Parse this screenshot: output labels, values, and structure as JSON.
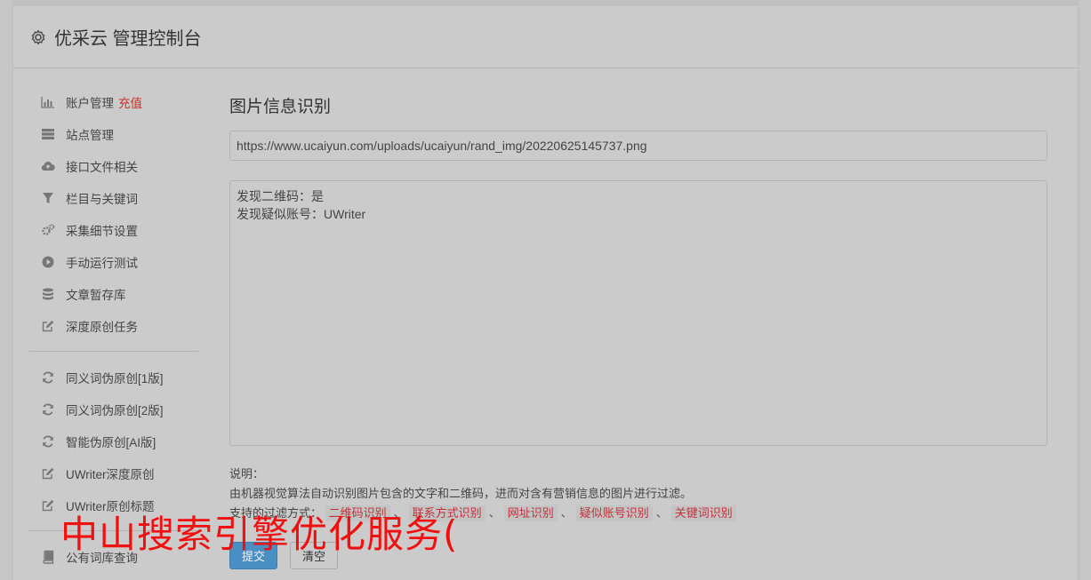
{
  "header": {
    "title": "优采云 管理控制台",
    "icon": "gear-icon"
  },
  "sidebar": {
    "group1": [
      {
        "label": "账户管理",
        "badge": "充值",
        "icon": "bar-chart-icon"
      },
      {
        "label": "站点管理",
        "icon": "server-icon"
      },
      {
        "label": "接口文件相关",
        "icon": "cloud-upload-icon"
      },
      {
        "label": "栏目与关键词",
        "icon": "filter-icon"
      },
      {
        "label": "采集细节设置",
        "icon": "gears-icon"
      },
      {
        "label": "手动运行测试",
        "icon": "play-circle-icon"
      },
      {
        "label": "文章暂存库",
        "icon": "database-icon"
      },
      {
        "label": "深度原创任务",
        "icon": "edit-icon"
      }
    ],
    "group2": [
      {
        "label": "同义词伪原创[1版]",
        "icon": "refresh-icon"
      },
      {
        "label": "同义词伪原创[2版]",
        "icon": "refresh-icon"
      },
      {
        "label": "智能伪原创[AI版]",
        "icon": "refresh-icon"
      },
      {
        "label": "UWriter深度原创",
        "icon": "edit-icon"
      },
      {
        "label": "UWriter原创标题",
        "icon": "edit-icon"
      }
    ],
    "group3": [
      {
        "label": "公有词库查询",
        "icon": "book-icon"
      }
    ]
  },
  "main": {
    "title": "图片信息识别",
    "image_url": "https://www.ucaiyun.com/uploads/ucaiyun/rand_img/20220625145737.png",
    "result_lines": [
      "发现二维码：是",
      "发现疑似账号：UWriter"
    ],
    "notes": {
      "heading": "说明：",
      "description": "由机器视觉算法自动识别图片包含的文字和二维码，进而对含有营销信息的图片进行过滤。",
      "filters_label": "支持的过滤方式：",
      "filters": [
        "二维码识别",
        "联系方式识别",
        "网址识别",
        "疑似账号识别",
        "关键词识别"
      ],
      "separator": "、"
    },
    "submit_label": "提交",
    "clear_label": "清空"
  },
  "watermark": "中山搜索引擎优化服务("
}
